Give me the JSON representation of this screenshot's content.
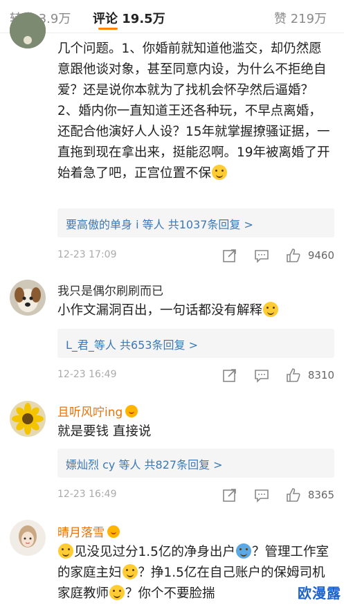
{
  "tabs": {
    "repost": "转发 3.9万",
    "comments": "评论 19.5万",
    "likes": "赞 219万"
  },
  "colors": {
    "accent": "#ff8200",
    "link": "#3c78b4",
    "vip_name": "#e8730a"
  },
  "comments": [
    {
      "username": "",
      "text": "几个问题。1、你婚前就知道他滥交，却仍然愿意跟他谈对象，甚至同意内设，为什么不拒绝自爱？还是说你本就为了找机会怀孕然后逼婚？2、婚内你一直知道王还各种玩，不早点离婚，还配合他演好人人设？15年就掌握撩骚证据，一直拖到现在拿出来，挺能忍啊。19年被离婚了开始着急了吧，正宫位置不保",
      "replies": "要高傲的单身 i 等人 共1037条回复 >",
      "time": "12-23 17:09",
      "likes": "9460"
    },
    {
      "username": "我只是偶尔刷刷而已",
      "text": "小作文漏洞百出，一句话都没有解释",
      "replies": "L_君_等人 共653条回复 >",
      "time": "12-23 16:49",
      "likes": "8310"
    },
    {
      "username": "且听风咛ing",
      "text": "就是要钱 直接说",
      "replies": "嫖灿烈 cy 等人 共827条回复 >",
      "time": "12-23 16:49",
      "likes": "8365"
    },
    {
      "username": "晴月落雪",
      "text_parts": [
        "见没见过分1.5亿的净身出户",
        "？管理工作室的家庭主妇",
        "？挣1.5亿在自己账户的保姆司机家庭教师",
        "？你个不要脸揣"
      ]
    }
  ],
  "watermark": "欧漫露"
}
